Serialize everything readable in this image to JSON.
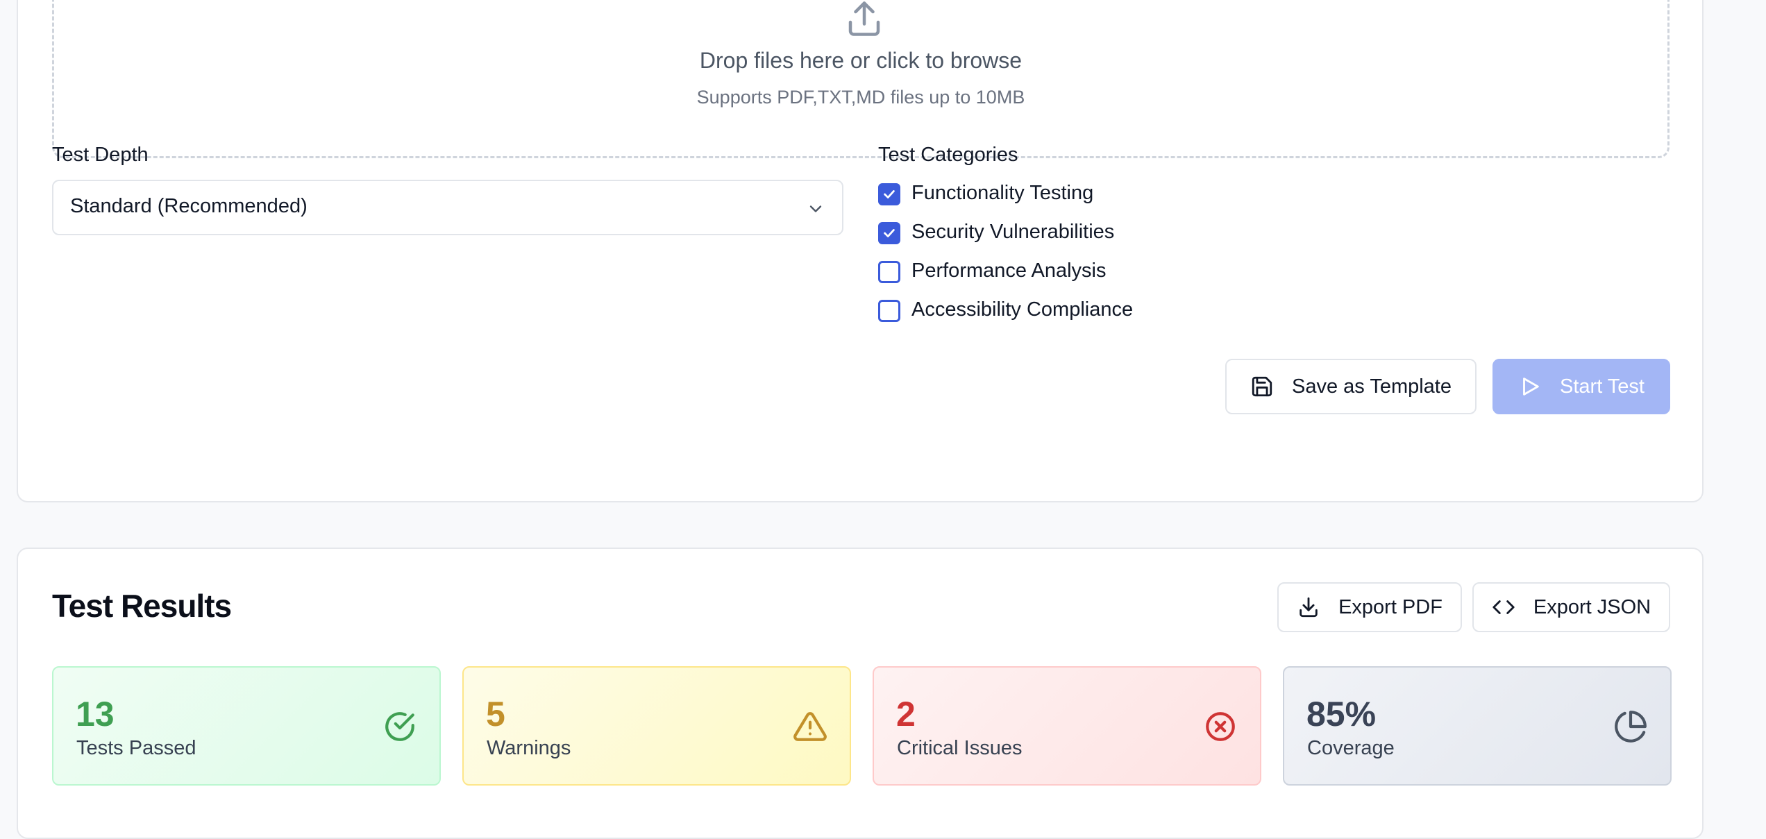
{
  "upload": {
    "title": "Drop files here or click to browse",
    "subtitle": "Supports PDF,TXT,MD files up to 10MB",
    "icon": "upload-icon"
  },
  "test_depth": {
    "label": "Test Depth",
    "selected": "Standard (Recommended)"
  },
  "test_categories": {
    "label": "Test Categories",
    "items": [
      {
        "label": "Functionality Testing",
        "checked": true
      },
      {
        "label": "Security Vulnerabilities",
        "checked": true
      },
      {
        "label": "Performance Analysis",
        "checked": false
      },
      {
        "label": "Accessibility Compliance",
        "checked": false
      }
    ]
  },
  "actions": {
    "save_template_label": "Save as Template",
    "start_test_label": "Start Test"
  },
  "results": {
    "title": "Test Results",
    "export_pdf_label": "Export PDF",
    "export_json_label": "Export JSON",
    "stats": [
      {
        "value": "13",
        "label": "Tests Passed",
        "icon": "check-circle-icon",
        "color": "#3f9f52"
      },
      {
        "value": "5",
        "label": "Warnings",
        "icon": "warning-triangle-icon",
        "color": "#c2902a"
      },
      {
        "value": "2",
        "label": "Critical Issues",
        "icon": "x-circle-icon",
        "color": "#cf3434"
      },
      {
        "value": "85%",
        "label": "Coverage",
        "icon": "pie-chart-icon",
        "color": "#3a4356"
      }
    ]
  },
  "colors": {
    "accent": "#3b5bdb",
    "primary_disabled": "#a3b6f5"
  }
}
